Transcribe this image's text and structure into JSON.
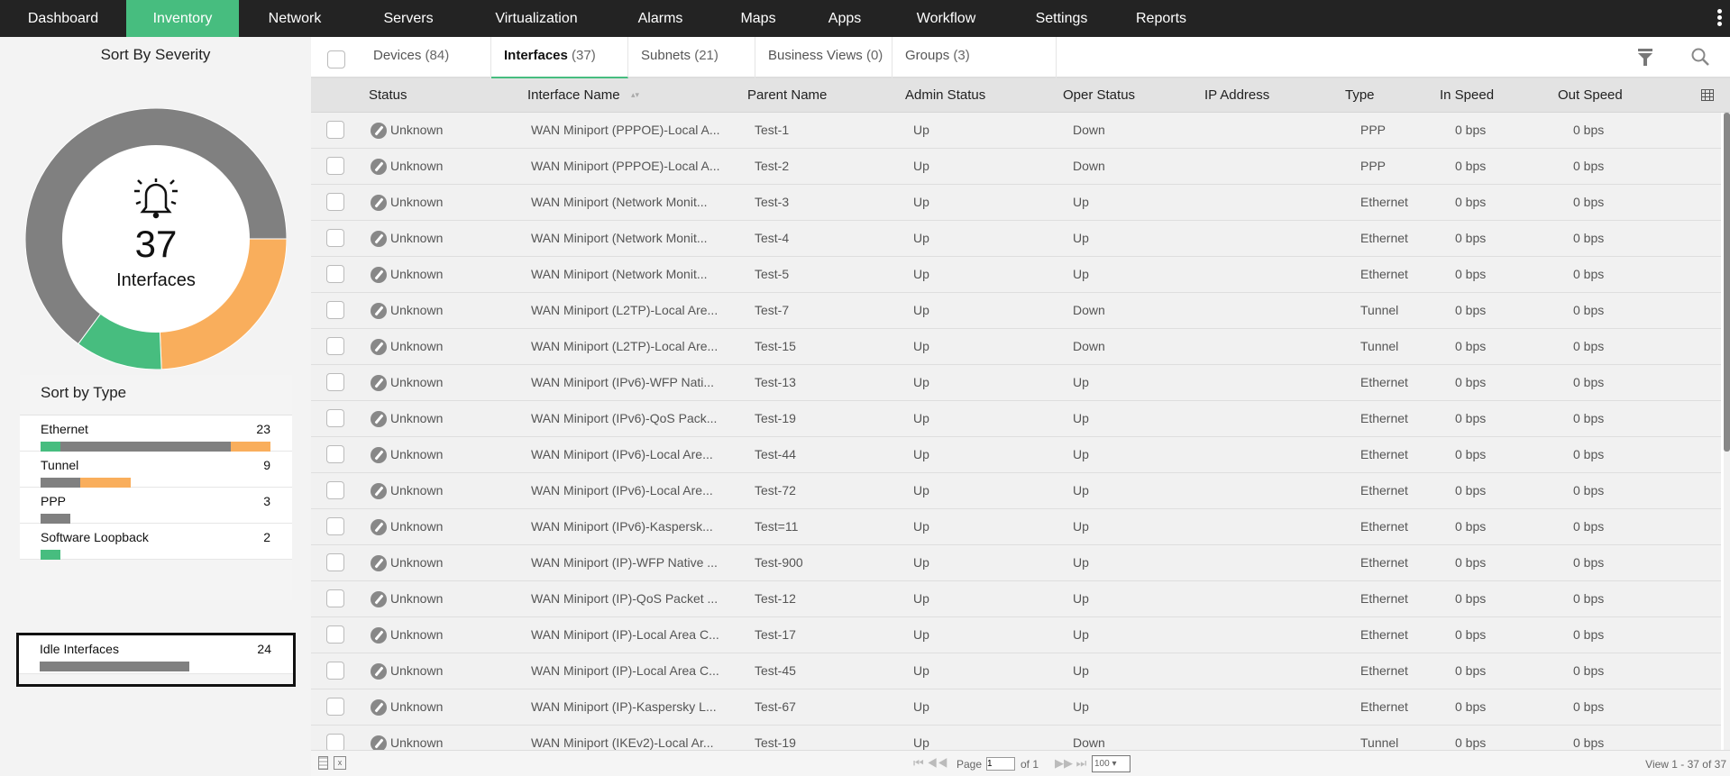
{
  "nav": {
    "items": [
      "Dashboard",
      "Inventory",
      "Network",
      "Servers",
      "Virtualization",
      "Alarms",
      "Maps",
      "Apps",
      "Workflow",
      "Settings",
      "Reports"
    ],
    "active": "Inventory"
  },
  "severity": {
    "title": "Sort By Severity",
    "count": "37",
    "label": "Interfaces",
    "colors": {
      "unknown": "#808080",
      "attention": "#f9ae5c",
      "clear": "#47bd7f"
    },
    "slices": [
      {
        "color": "#f9ae5c",
        "value": 9
      },
      {
        "color": "#47bd7f",
        "value": 4
      },
      {
        "color": "#808080",
        "value": 24
      }
    ]
  },
  "types": {
    "title": "Sort by Type",
    "items": [
      {
        "label": "Ethernet",
        "count": "23",
        "segments": [
          {
            "c": "#47bd7f",
            "v": 2
          },
          {
            "c": "#808080",
            "v": 17
          },
          {
            "c": "#f9ae5c",
            "v": 4
          }
        ]
      },
      {
        "label": "Tunnel",
        "count": "9",
        "segments": [
          {
            "c": "#808080",
            "v": 4
          },
          {
            "c": "#f9ae5c",
            "v": 5
          }
        ]
      },
      {
        "label": "PPP",
        "count": "3",
        "segments": [
          {
            "c": "#808080",
            "v": 3
          }
        ]
      },
      {
        "label": "Software Loopback",
        "count": "2",
        "segments": [
          {
            "c": "#47bd7f",
            "v": 2
          }
        ]
      }
    ],
    "idle": {
      "label": "Idle Interfaces",
      "count": "24",
      "fraction": 0.65
    }
  },
  "tabs": [
    {
      "label": "Devices",
      "count": "(84)"
    },
    {
      "label": "Interfaces",
      "count": "(37)",
      "active": true
    },
    {
      "label": "Subnets",
      "count": "(21)"
    },
    {
      "label": "Business Views",
      "count": "(0)"
    },
    {
      "label": "Groups",
      "count": "(3)"
    }
  ],
  "columns": [
    "Status",
    "Interface Name",
    "Parent Name",
    "Admin Status",
    "Oper Status",
    "IP Address",
    "Type",
    "In Speed",
    "Out Speed"
  ],
  "rows": [
    [
      "Unknown",
      "WAN Miniport (PPPOE)-Local A...",
      "Test-1",
      "Up",
      "Down",
      "",
      "PPP",
      "0 bps",
      "0 bps"
    ],
    [
      "Unknown",
      "WAN Miniport (PPPOE)-Local A...",
      "Test-2",
      "Up",
      "Down",
      "",
      "PPP",
      "0 bps",
      "0 bps"
    ],
    [
      "Unknown",
      "WAN Miniport (Network Monit...",
      "Test-3",
      "Up",
      "Up",
      "",
      "Ethernet",
      "0 bps",
      "0 bps"
    ],
    [
      "Unknown",
      "WAN Miniport (Network Monit...",
      "Test-4",
      "Up",
      "Up",
      "",
      "Ethernet",
      "0 bps",
      "0 bps"
    ],
    [
      "Unknown",
      "WAN Miniport (Network Monit...",
      "Test-5",
      "Up",
      "Up",
      "",
      "Ethernet",
      "0 bps",
      "0 bps"
    ],
    [
      "Unknown",
      "WAN Miniport (L2TP)-Local Are...",
      "Test-7",
      "Up",
      "Down",
      "",
      "Tunnel",
      "0 bps",
      "0 bps"
    ],
    [
      "Unknown",
      "WAN Miniport (L2TP)-Local Are...",
      "Test-15",
      "Up",
      "Down",
      "",
      "Tunnel",
      "0 bps",
      "0 bps"
    ],
    [
      "Unknown",
      "WAN Miniport (IPv6)-WFP Nati...",
      "Test-13",
      "Up",
      "Up",
      "",
      "Ethernet",
      "0 bps",
      "0 bps"
    ],
    [
      "Unknown",
      "WAN Miniport (IPv6)-QoS Pack...",
      "Test-19",
      "Up",
      "Up",
      "",
      "Ethernet",
      "0 bps",
      "0 bps"
    ],
    [
      "Unknown",
      "WAN Miniport (IPv6)-Local Are...",
      "Test-44",
      "Up",
      "Up",
      "",
      "Ethernet",
      "0 bps",
      "0 bps"
    ],
    [
      "Unknown",
      "WAN Miniport (IPv6)-Local Are...",
      "Test-72",
      "Up",
      "Up",
      "",
      "Ethernet",
      "0 bps",
      "0 bps"
    ],
    [
      "Unknown",
      "WAN Miniport (IPv6)-Kaspersk...",
      "Test=11",
      "Up",
      "Up",
      "",
      "Ethernet",
      "0 bps",
      "0 bps"
    ],
    [
      "Unknown",
      "WAN Miniport (IP)-WFP Native ...",
      "Test-900",
      "Up",
      "Up",
      "",
      "Ethernet",
      "0 bps",
      "0 bps"
    ],
    [
      "Unknown",
      "WAN Miniport (IP)-QoS Packet ...",
      "Test-12",
      "Up",
      "Up",
      "",
      "Ethernet",
      "0 bps",
      "0 bps"
    ],
    [
      "Unknown",
      "WAN Miniport (IP)-Local Area C...",
      "Test-17",
      "Up",
      "Up",
      "",
      "Ethernet",
      "0 bps",
      "0 bps"
    ],
    [
      "Unknown",
      "WAN Miniport (IP)-Local Area C...",
      "Test-45",
      "Up",
      "Up",
      "",
      "Ethernet",
      "0 bps",
      "0 bps"
    ],
    [
      "Unknown",
      "WAN Miniport (IP)-Kaspersky L...",
      "Test-67",
      "Up",
      "Up",
      "",
      "Ethernet",
      "0 bps",
      "0 bps"
    ],
    [
      "Unknown",
      "WAN Miniport (IKEv2)-Local Ar...",
      "Test-19",
      "Up",
      "Down",
      "",
      "Tunnel",
      "0 bps",
      "0 bps"
    ]
  ],
  "footer": {
    "page_label": "Page",
    "page": "1",
    "of": "of 1",
    "page_size": "100",
    "view": "View 1 - 37 of 37"
  }
}
